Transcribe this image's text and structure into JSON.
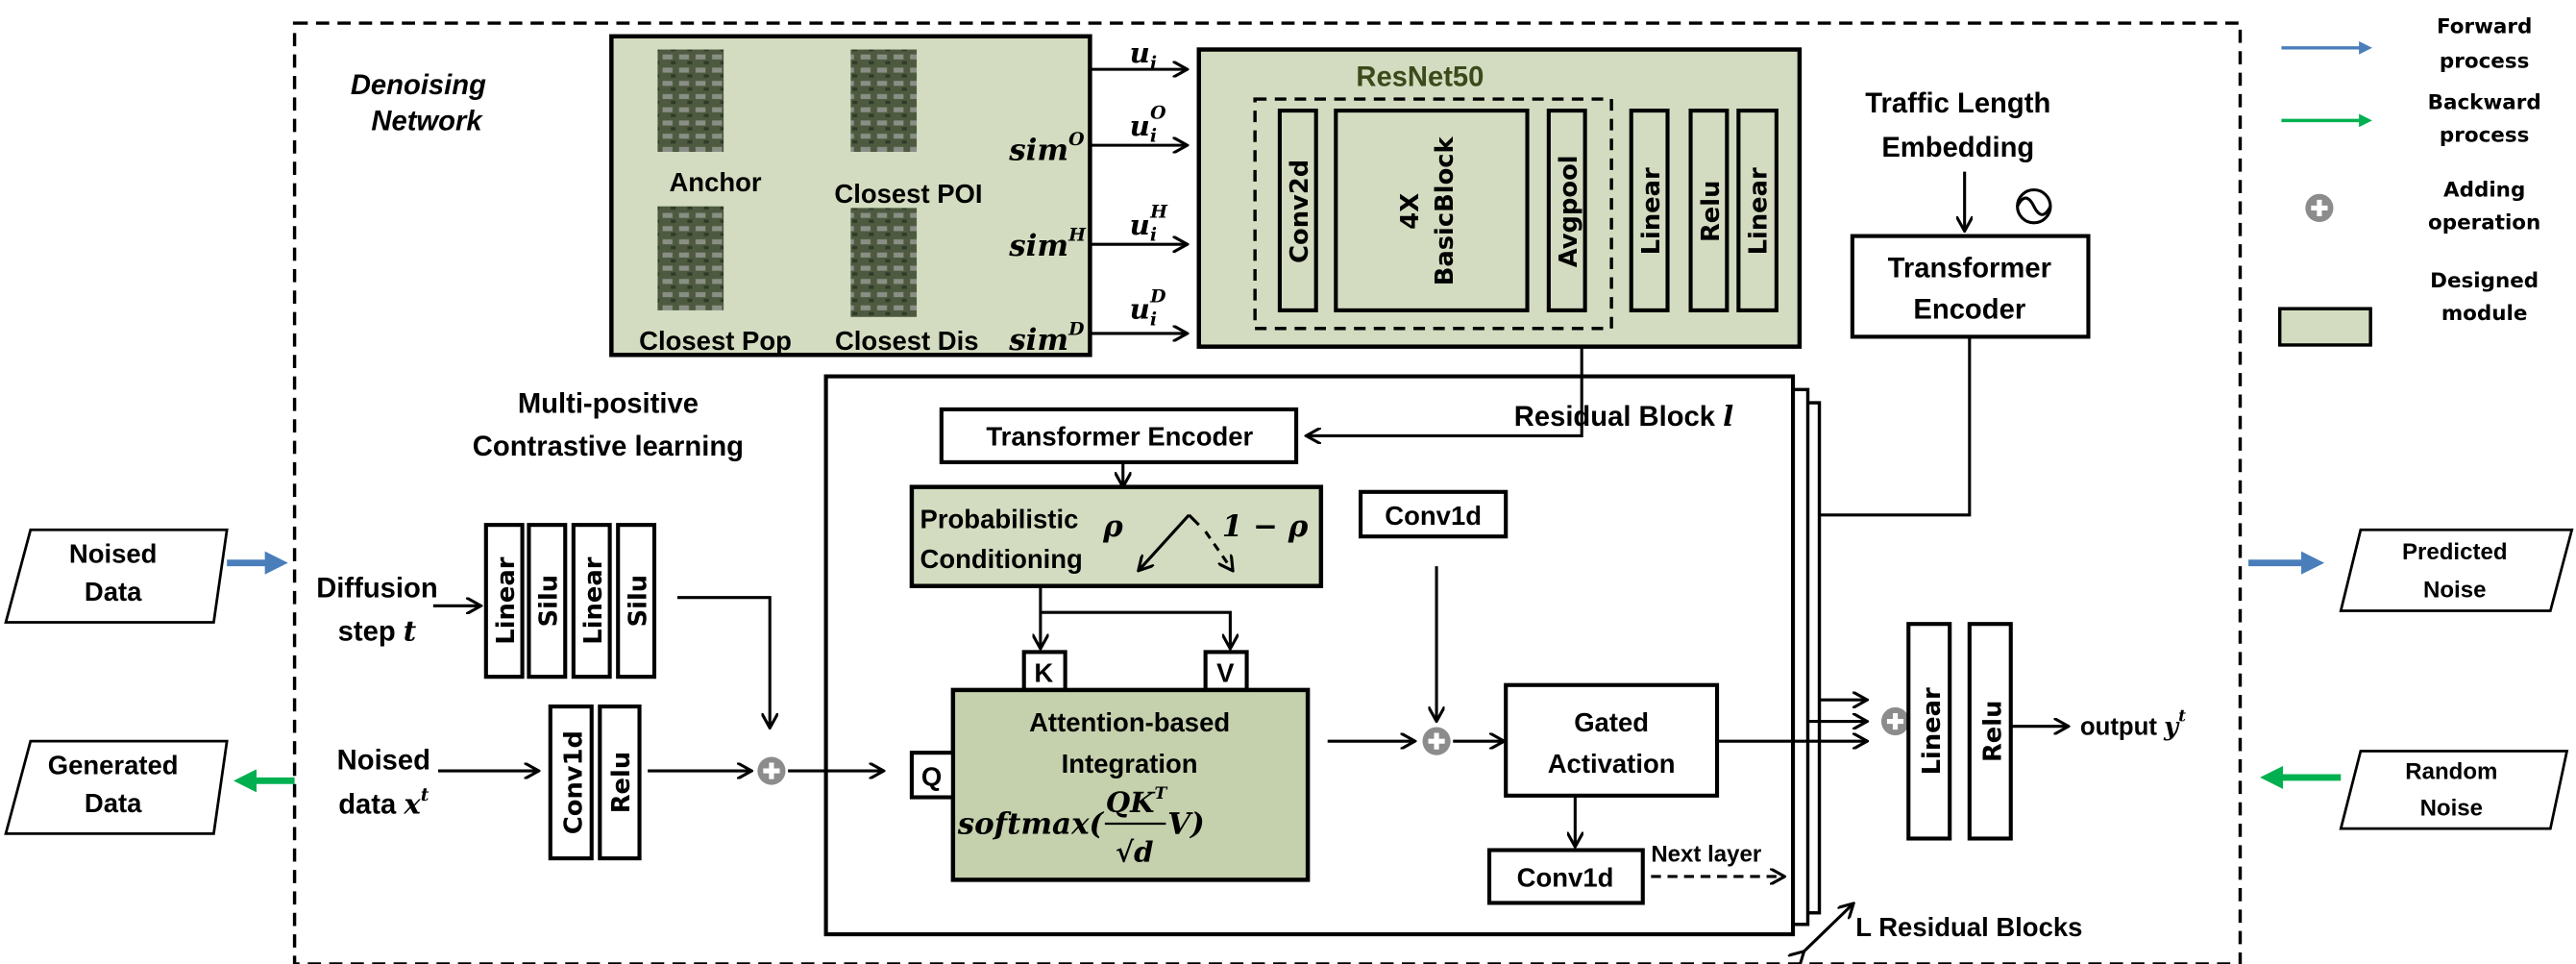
{
  "colors": {
    "designed_module": "#d3dcc0",
    "attention_module": "#c5d1ad",
    "forward": "#4a7ebb",
    "backward": "#00b050",
    "adding": "#8c8c8c",
    "resnet_title": "#3a4a1a"
  },
  "denoising_network": {
    "line1": "Denoising",
    "line2": "Network"
  },
  "images": {
    "anchor": "Anchor",
    "closest_poi": "Closest POI",
    "closest_pop": "Closest Pop",
    "closest_dis": "Closest Dis"
  },
  "sims": {
    "o": {
      "base": "sim",
      "sup": "O"
    },
    "h": {
      "base": "sim",
      "sup": "H"
    },
    "d": {
      "base": "sim",
      "sup": "D"
    }
  },
  "embeddings": [
    {
      "base": "u",
      "sub": "i",
      "sup": ""
    },
    {
      "base": "u",
      "sub": "i",
      "sup": "O"
    },
    {
      "base": "u",
      "sub": "i",
      "sup": "H"
    },
    {
      "base": "u",
      "sub": "i",
      "sup": "D"
    }
  ],
  "resnet": {
    "title": "ResNet50",
    "layers": [
      "Conv2d",
      "4X",
      "BasicBlock",
      "Avgpool",
      "Linear",
      "Relu",
      "Linear"
    ]
  },
  "traffic": {
    "line1": "Traffic Length",
    "line2": "Embedding",
    "encoder_line1": "Transformer",
    "encoder_line2": "Encoder",
    "sine_icon": "sine-wave-icon"
  },
  "residual_block": {
    "label": "Residual Block ",
    "label_var": "l",
    "transformer_encoder": "Transformer Encoder",
    "prob_line1": "Probabilistic",
    "prob_line2": "Conditioning",
    "rho": "ρ",
    "one_minus_rho": "1 − ρ",
    "k": "K",
    "v": "V",
    "q": "Q",
    "attn_line1": "Attention-based",
    "attn_line2": "Integration",
    "formula_prefix": "softmax(",
    "formula_num": "QK",
    "formula_num_sup": "T",
    "formula_den": "√d",
    "formula_suffix": "V)",
    "conv1d_top": "Conv1d",
    "gated_line1": "Gated",
    "gated_line2": "Activation",
    "conv1d_bottom": "Conv1d",
    "next_layer": "Next layer",
    "stack_label": "L Residual Blocks"
  },
  "contrastive": {
    "line1": "Multi-positive",
    "line2": "Contrastive learning"
  },
  "diffusion": {
    "line1": "Diffusion",
    "line2": "step ",
    "var": "t",
    "layers": [
      "Linear",
      "Silu",
      "Linear",
      "Silu"
    ]
  },
  "noised": {
    "line1": "Noised",
    "line2": "data ",
    "var": "x",
    "sup": "t",
    "layers": [
      "Conv1d",
      "Relu"
    ]
  },
  "output": {
    "layers": [
      "Linear",
      "Relu"
    ],
    "label": "output ",
    "var": "y",
    "sup": "t"
  },
  "io": {
    "noised_data": [
      "Noised",
      "Data"
    ],
    "generated_data": [
      "Generated",
      "Data"
    ],
    "predicted_noise": [
      "Predicted",
      "Noise"
    ],
    "random_noise": [
      "Random",
      "Noise"
    ]
  },
  "legend": {
    "forward": [
      "Forward",
      "process"
    ],
    "backward": [
      "Backward",
      "process"
    ],
    "adding": [
      "Adding",
      "operation"
    ],
    "designed": [
      "Designed",
      "module"
    ]
  }
}
